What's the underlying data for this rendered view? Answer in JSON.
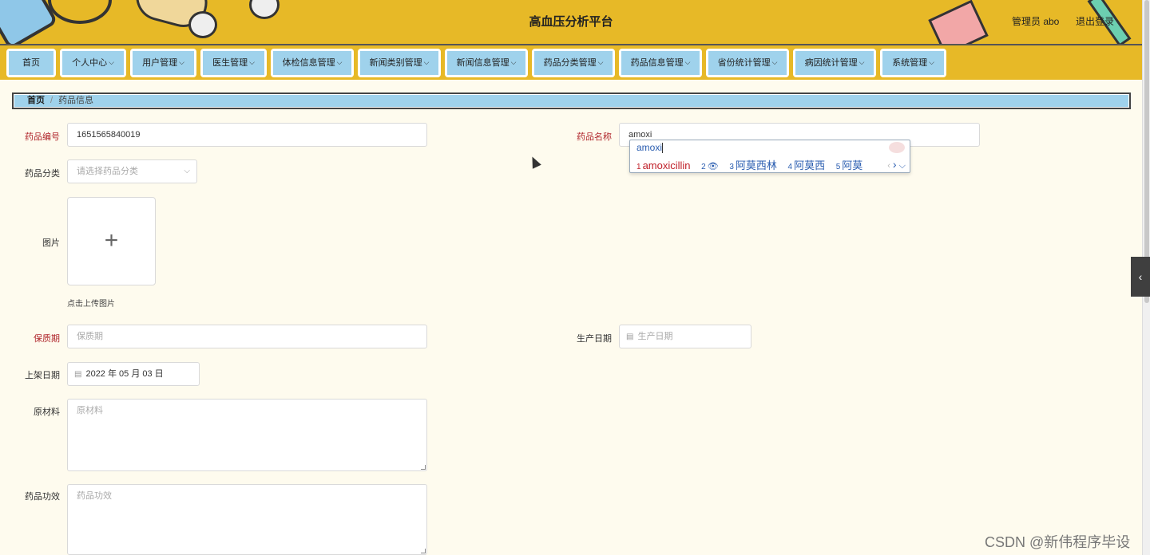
{
  "header": {
    "title": "高血压分析平台",
    "user": "管理员 abo",
    "logout": "退出登录"
  },
  "nav": [
    {
      "label": "首页",
      "dropdown": false
    },
    {
      "label": "个人中心",
      "dropdown": true
    },
    {
      "label": "用户管理",
      "dropdown": true
    },
    {
      "label": "医生管理",
      "dropdown": true
    },
    {
      "label": "体检信息管理",
      "dropdown": true
    },
    {
      "label": "新闻类别管理",
      "dropdown": true
    },
    {
      "label": "新闻信息管理",
      "dropdown": true
    },
    {
      "label": "药品分类管理",
      "dropdown": true
    },
    {
      "label": "药品信息管理",
      "dropdown": true
    },
    {
      "label": "省份统计管理",
      "dropdown": true
    },
    {
      "label": "病因统计管理",
      "dropdown": true
    },
    {
      "label": "系统管理",
      "dropdown": true
    }
  ],
  "breadcrumb": {
    "home": "首页",
    "current": "药品信息"
  },
  "form": {
    "code": {
      "label": "药品编号",
      "value": "1651565840019"
    },
    "name": {
      "label": "药品名称",
      "value": "amoxi"
    },
    "category": {
      "label": "药品分类",
      "placeholder": "请选择药品分类"
    },
    "image": {
      "label": "图片",
      "hint": "点击上传图片"
    },
    "shelf_life": {
      "label": "保质期",
      "placeholder": "保质期"
    },
    "production_date": {
      "label": "生产日期",
      "placeholder": "生产日期"
    },
    "listing_date": {
      "label": "上架日期",
      "value": "2022 年 05 月 03 日"
    },
    "ingredients": {
      "label": "原材料",
      "placeholder": "原材料"
    },
    "efficacy": {
      "label": "药品功效",
      "placeholder": "药品功效"
    }
  },
  "ime": {
    "composition": "amoxi",
    "candidates": [
      {
        "num": "1",
        "text": "amoxicillin"
      },
      {
        "num": "2",
        "text": "👁"
      },
      {
        "num": "3",
        "text": "阿莫西林"
      },
      {
        "num": "4",
        "text": "阿莫西"
      },
      {
        "num": "5",
        "text": "阿莫"
      }
    ]
  },
  "watermark": "CSDN @新伟程序毕设",
  "colors": {
    "header": "#e7b927",
    "nav_button": "#9fd2ec",
    "required_label": "#b0262c",
    "background": "#fefbee"
  }
}
